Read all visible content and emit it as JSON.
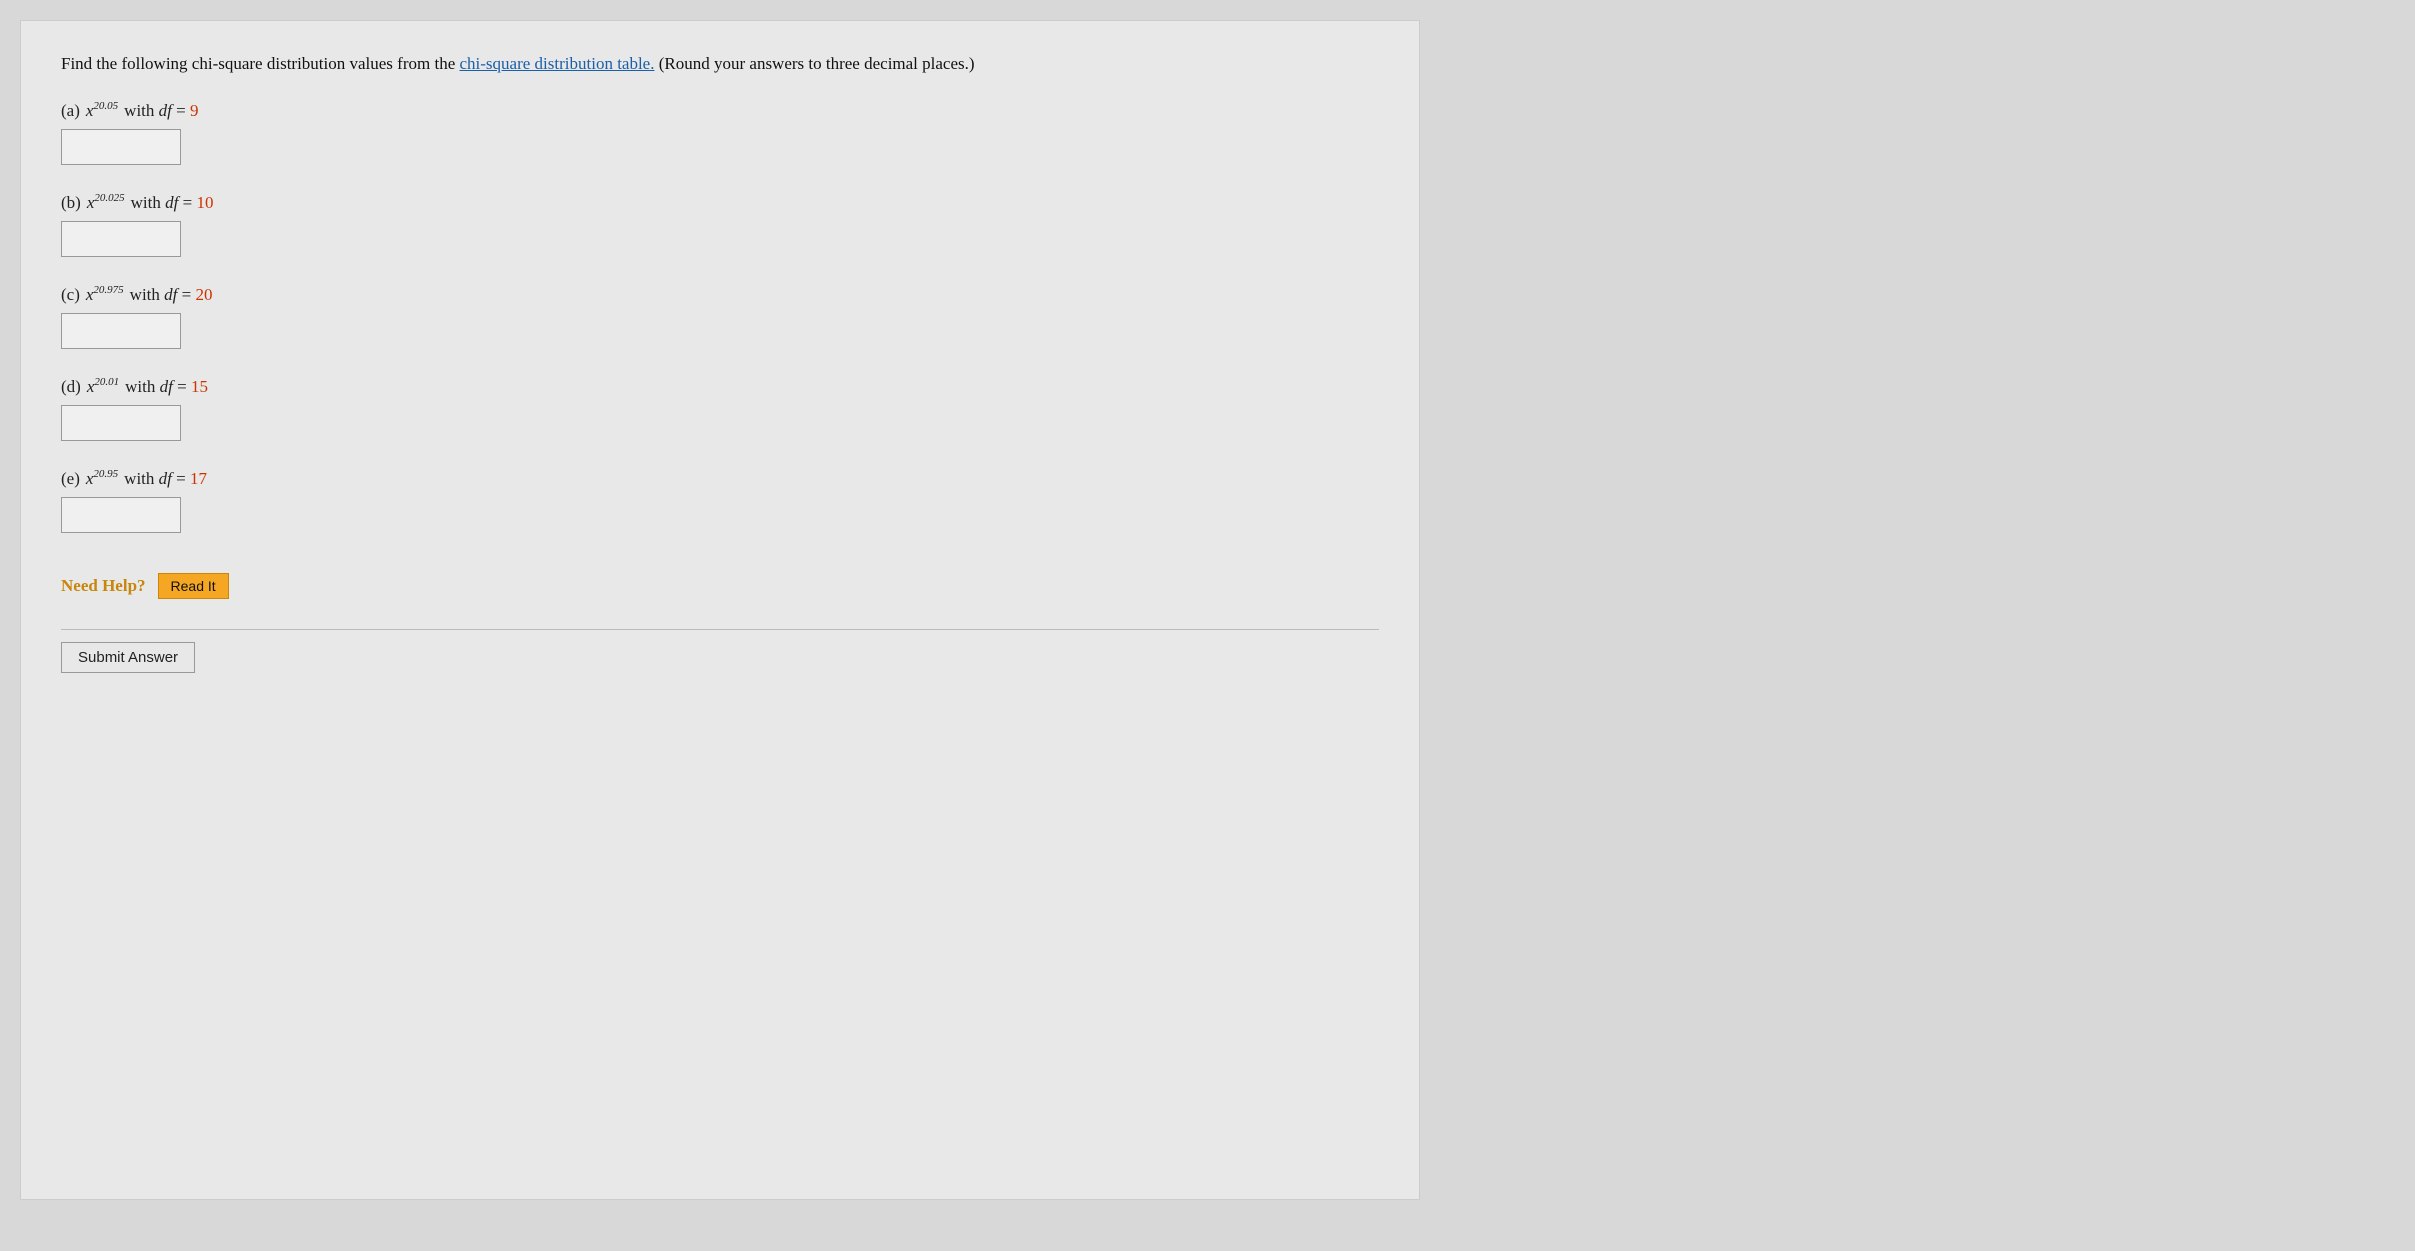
{
  "instructions": {
    "text": "Find the following chi-square distribution values from the ",
    "link_text": "chi-square distribution table.",
    "suffix": " (Round your answers to three decimal places.)"
  },
  "problems": [
    {
      "id": "a",
      "letter": "(a)",
      "chi_subscript": "0.05",
      "df_value": "9",
      "df_color": "#cc3300",
      "input_value": ""
    },
    {
      "id": "b",
      "letter": "(b)",
      "chi_subscript": "0.025",
      "df_value": "10",
      "df_color": "#cc3300",
      "input_value": ""
    },
    {
      "id": "c",
      "letter": "(c)",
      "chi_subscript": "0.975",
      "df_value": "20",
      "df_color": "#cc3300",
      "input_value": ""
    },
    {
      "id": "d",
      "letter": "(d)",
      "chi_subscript": "0.01",
      "df_value": "15",
      "df_color": "#cc3300",
      "input_value": ""
    },
    {
      "id": "e",
      "letter": "(e)",
      "chi_subscript": "0.95",
      "df_value": "17",
      "df_color": "#cc3300",
      "input_value": ""
    }
  ],
  "need_help": {
    "label": "Need Help?",
    "button_label": "Read It"
  },
  "submit": {
    "button_label": "Submit Answer"
  }
}
